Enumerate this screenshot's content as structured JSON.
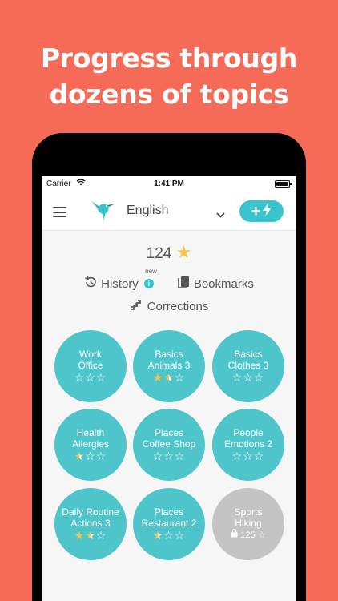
{
  "headline": {
    "line1": "Progress through",
    "line2": "dozens of topics"
  },
  "status_bar": {
    "carrier": "Carrier",
    "time": "1:41 PM"
  },
  "navbar": {
    "language": "English",
    "boost_label": "+"
  },
  "summary": {
    "stars_total": "124",
    "history_label": "History",
    "new_tag": "new",
    "info_glyph": "i",
    "bookmarks_label": "Bookmarks",
    "corrections_label": "Corrections"
  },
  "topics": [
    {
      "category": "Work",
      "name": "Office",
      "rating": 0
    },
    {
      "category": "Basics",
      "name": "Animals 3",
      "rating": 1.5
    },
    {
      "category": "Basics",
      "name": "Clothes 3",
      "rating": 0
    },
    {
      "category": "Health",
      "name": "Allergies",
      "rating": 0.5
    },
    {
      "category": "Places",
      "name": "Coffee Shop",
      "rating": 0
    },
    {
      "category": "People",
      "name": "Emotions 2",
      "rating": 0
    },
    {
      "category": "Daily Routine",
      "name": "Actions 3",
      "rating": 1.5
    },
    {
      "category": "Places",
      "name": "Restaurant 2",
      "rating": 0.5
    },
    {
      "category": "Sports",
      "name": "Hiking",
      "locked": true,
      "unlock_stars": "125"
    }
  ],
  "colors": {
    "background": "#f56b58",
    "accent": "#38c4cd",
    "topic_active": "#4dc5cb",
    "topic_locked": "#c4c4c4",
    "star": "#f5c44e"
  }
}
